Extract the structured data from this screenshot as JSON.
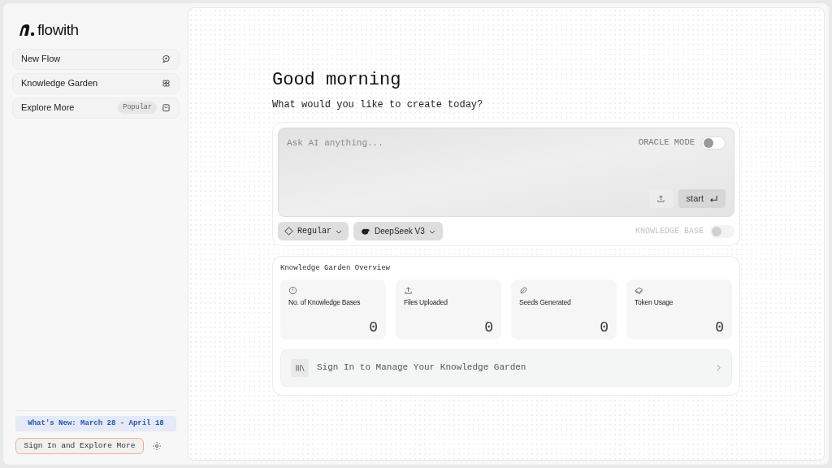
{
  "sidebar": {
    "logo": "flowith",
    "items": [
      {
        "label": "New Flow"
      },
      {
        "label": "Knowledge Garden"
      },
      {
        "label": "Explore More",
        "badge": "Popular"
      }
    ],
    "whats_new": "What's New: March 28 - April 18",
    "sign_in_button": "Sign In and Explore More"
  },
  "main": {
    "greeting": "Good morning",
    "subtitle": "What would you like to create today?",
    "prompt": {
      "placeholder": "Ask AI anything...",
      "oracle_mode": {
        "label": "ORACLE MODE",
        "on": false
      },
      "start_button": "start"
    },
    "mode_dropdown": "Regular",
    "model_dropdown": "DeepSeek V3",
    "knowledge_base": {
      "label": "KNOWLEDGE BASE",
      "on": false,
      "disabled": true
    },
    "overview": {
      "title": "Knowledge Garden Overview",
      "stats": [
        {
          "kind": "info",
          "label": "No. of Knowledge Bases",
          "value": "0"
        },
        {
          "kind": "upload",
          "label": "Files Uploaded",
          "value": "0"
        },
        {
          "kind": "seed",
          "label": "Seeds Generated",
          "value": "0"
        },
        {
          "kind": "token",
          "label": "Token Usage",
          "value": "0"
        }
      ],
      "sign_in_banner": "Sign In to Manage Your Knowledge Garden"
    }
  }
}
